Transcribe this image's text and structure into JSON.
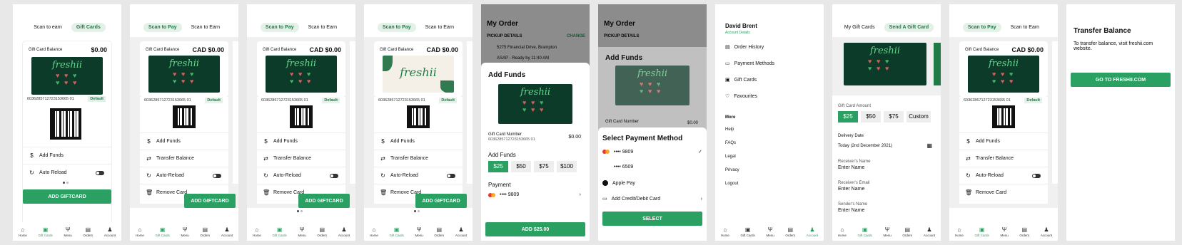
{
  "nav": {
    "home": "Home",
    "gift": "Gift Cards",
    "menu": "Menu",
    "orders": "Orders",
    "account": "Account"
  },
  "s1": {
    "tab1": "Scan to earn",
    "tab2": "Gift Cards",
    "balance_label": "Gift Card Balance",
    "balance": "$0.00",
    "logo": "freshii",
    "card_number": "6036285712723153665 01",
    "default": "Default",
    "add_funds": "Add Funds",
    "auto_reload": "Auto Reload",
    "button": "ADD GIFTCARD"
  },
  "s2": {
    "tab1": "Scan to Pay",
    "tab2": "Scan to Earn",
    "balance_label": "Gift Card Balance",
    "balance": "CAD $0.00",
    "card_number": "6036285712723153665 01",
    "default": "Default",
    "add_funds": "Add Funds",
    "transfer": "Transfer Balance",
    "auto_reload": "Auto-Reload",
    "remove": "Remove Card",
    "button": "ADD GIFTCARD"
  },
  "s5": {
    "title": "My Order",
    "pickup": "PICKUP DETAILS",
    "change": "CHANGE",
    "address": "5275 Financial Drive, Brampton",
    "time": "ASAP - Ready by 11:40 AM",
    "sheet_title": "Add Funds",
    "gc_number_label": "Gift Card Number",
    "gc_number": "6036285712723153665 01",
    "gc_amount": "$0.00",
    "funds_label": "Add Funds",
    "amounts": [
      "$25",
      "$50",
      "$75",
      "$100"
    ],
    "payment_label": "Payment",
    "card": "•••• 9809",
    "button": "ADD $25.00"
  },
  "s6": {
    "title": "My Order",
    "pickup": "PICKUP DETAILS",
    "behind_title": "Add Funds",
    "gc_number_label": "Gift Card Number",
    "gc_amount": "$0.00",
    "sheet_title": "Select Payment Method",
    "card1": "•••• 9809",
    "card2": "•••• 6509",
    "applepay": "Apple Pay",
    "add_card": "Add Credit/Debit Card",
    "button": "SELECT"
  },
  "s7": {
    "name": "David Brent",
    "details": "Account Details",
    "items": [
      "Order History",
      "Payment Methods",
      "Gift Cards",
      "Favourites"
    ],
    "more": "More",
    "more_items": [
      "Help",
      "FAQs",
      "Legal",
      "Privacy",
      "Logout"
    ]
  },
  "s8": {
    "tab1": "My Gift Cards",
    "tab2": "Send A Gift Card",
    "amount_label": "Gift Card Amount",
    "amounts": [
      "$25",
      "$50",
      "$75",
      "Custom"
    ],
    "date_label": "Delivery Date",
    "date": "Today (2nd December 2021)",
    "rname_label": "Receiver's Name",
    "rname": "Enter Name",
    "remail_label": "Receiver's Email",
    "remail": "Enter Name",
    "sname_label": "Sender's Name",
    "sname": "Enter Name"
  },
  "s10": {
    "title": "Transfer Balance",
    "text": "To transfer balance, visit freshii.com website.",
    "button": "GO TO FRESHII.COM"
  },
  "colors": {
    "brand": "#2aa062",
    "dark_card": "#0d3b2a"
  }
}
